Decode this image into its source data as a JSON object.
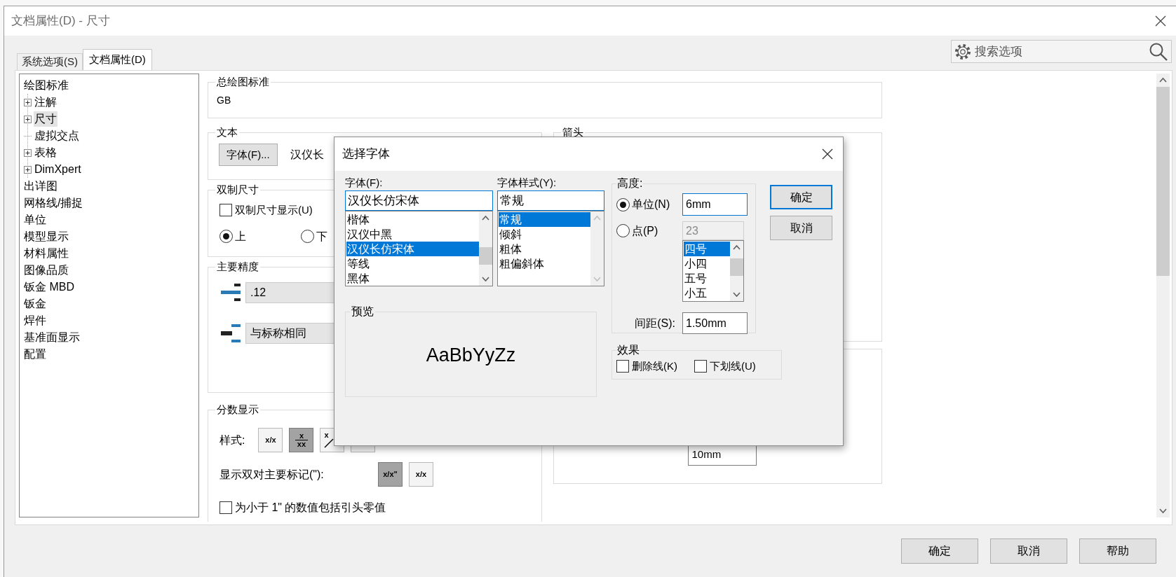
{
  "window": {
    "title": "文档属性(D) - 尺寸"
  },
  "tabs": [
    {
      "label": "系统选项(S)",
      "selected": false
    },
    {
      "label": "文档属性(D)",
      "selected": true
    }
  ],
  "search": {
    "placeholder": "搜索选项"
  },
  "tree": [
    {
      "label": "绘图标准",
      "selected": false,
      "children": [
        {
          "label": "注解",
          "kind": "collapsed",
          "selected": false
        },
        {
          "label": "尺寸",
          "kind": "collapsed",
          "selected": true
        },
        {
          "label": "虚拟交点",
          "kind": "leaf",
          "selected": false
        },
        {
          "label": "表格",
          "kind": "collapsed",
          "selected": false
        },
        {
          "label": "DimXpert",
          "kind": "collapsed",
          "selected": false
        }
      ]
    },
    {
      "label": "出详图",
      "selected": false
    },
    {
      "label": "网格线/捕捉",
      "selected": false
    },
    {
      "label": "单位",
      "selected": false
    },
    {
      "label": "模型显示",
      "selected": false
    },
    {
      "label": "材料属性",
      "selected": false
    },
    {
      "label": "图像品质",
      "selected": false
    },
    {
      "label": "钣金 MBD",
      "selected": false
    },
    {
      "label": "钣金",
      "selected": false
    },
    {
      "label": "焊件",
      "selected": false
    },
    {
      "label": "基准面显示",
      "selected": false
    },
    {
      "label": "配置",
      "selected": false
    }
  ],
  "drawing_standard": {
    "title": "总绘图标准",
    "value": "GB"
  },
  "text": {
    "title": "文本",
    "font_button": "字体(F)...",
    "font_name": "汉仪长"
  },
  "dual": {
    "title": "双制尺寸",
    "checkbox": {
      "label": "双制尺寸显示(U)",
      "checked": false
    },
    "radios": [
      {
        "label": "上",
        "selected": true
      },
      {
        "label": "下",
        "selected": false
      }
    ]
  },
  "precision": {
    "title": "主要精度",
    "dropdowns": [
      {
        "kind": "value",
        "value": ".12"
      },
      {
        "kind": "tolerance",
        "value": "与标称相同"
      }
    ]
  },
  "fraction": {
    "title": "分数显示",
    "style_label": "样式:",
    "styles": [
      {
        "kind": "slash",
        "label": "x/x",
        "selected": false
      },
      {
        "kind": "stacked",
        "top": "x",
        "bottom": "xx",
        "selected": true
      },
      {
        "kind": "diagonal",
        "label": "x",
        "selected": false
      },
      {
        "kind": "blank",
        "selected": false
      }
    ],
    "dual_label": "显示双对主要标记(\"):",
    "dual_styles": [
      {
        "label": "x/x\"",
        "selected": true
      },
      {
        "label": "x/x",
        "selected": false
      }
    ],
    "checkbox": {
      "label": "为小于 1\" 的数值包括引头零值",
      "checked": false
    }
  },
  "arrows": {
    "title": "箭头"
  },
  "lower_right": {
    "value": "10mm"
  },
  "font_dialog": {
    "title": "选择字体",
    "font": {
      "label": "字体(F):",
      "value": "汉仪长仿宋体",
      "options": [
        {
          "label": "楷体",
          "selected": false
        },
        {
          "label": "汉仪中黑",
          "selected": false
        },
        {
          "label": "汉仪长仿宋体",
          "selected": true
        },
        {
          "label": "等线",
          "selected": false
        },
        {
          "label": "黑体",
          "selected": false
        }
      ]
    },
    "style": {
      "label": "字体样式(Y):",
      "value": "常规",
      "options": [
        {
          "label": "常规",
          "selected": true
        },
        {
          "label": "倾斜",
          "selected": false
        },
        {
          "label": "粗体",
          "selected": false
        },
        {
          "label": "粗偏斜体",
          "selected": false
        }
      ]
    },
    "height": {
      "title": "高度:",
      "radios": [
        {
          "label": "单位(N)",
          "selected": true,
          "value": "6mm"
        },
        {
          "label": "点(P)",
          "selected": false,
          "value": "23"
        }
      ],
      "sizes": [
        {
          "label": "四号",
          "selected": true
        },
        {
          "label": "小四",
          "selected": false
        },
        {
          "label": "五号",
          "selected": false
        },
        {
          "label": "小五",
          "selected": false
        }
      ],
      "spacing_label": "间距(S):",
      "spacing": "1.50mm"
    },
    "preview": {
      "title": "预览",
      "sample": "AaBbYyZz"
    },
    "effects": {
      "title": "效果",
      "checkboxes": [
        {
          "label": "删除线(K)",
          "checked": false
        },
        {
          "label": "下划线(U)",
          "checked": false
        }
      ]
    },
    "buttons": [
      {
        "label": "确定",
        "default": true
      },
      {
        "label": "取消",
        "default": false
      }
    ]
  },
  "buttons": [
    "确定",
    "取消",
    "帮助"
  ]
}
